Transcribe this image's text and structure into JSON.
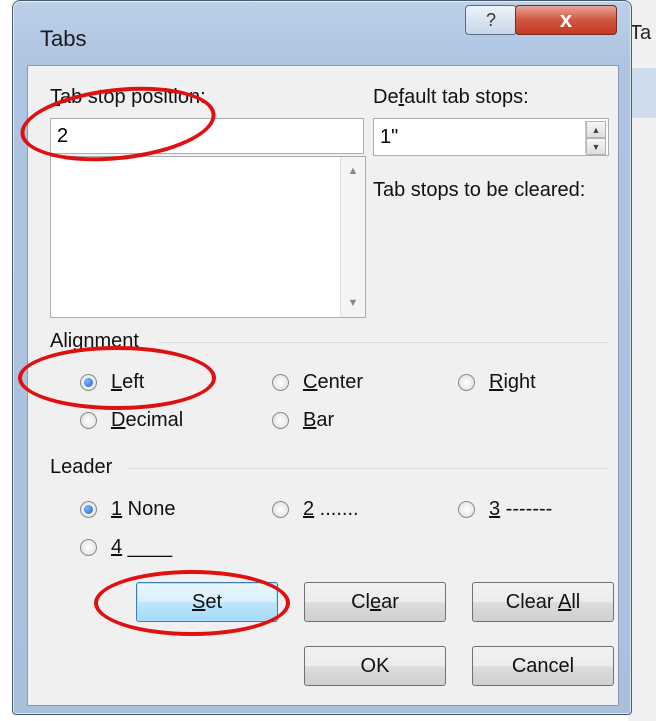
{
  "window": {
    "title": "Tabs",
    "help_glyph": "?",
    "close_glyph": "x",
    "background_app_text": "Ta"
  },
  "tab_stop_position": {
    "label": "Tab stop position:",
    "value": "2",
    "list_items": []
  },
  "default_tab_stops": {
    "label": "Default tab stops:",
    "value": "1\""
  },
  "tab_stops_cleared": {
    "label": "Tab stops to be cleared:"
  },
  "alignment": {
    "heading": "Alignment",
    "options": [
      {
        "label": "Left",
        "checked": true
      },
      {
        "label": "Center",
        "checked": false
      },
      {
        "label": "Right",
        "checked": false
      },
      {
        "label": "Decimal",
        "checked": false
      },
      {
        "label": "Bar",
        "checked": false
      }
    ]
  },
  "leader": {
    "heading": "Leader",
    "options": [
      {
        "label": "1 None",
        "checked": true
      },
      {
        "label": "2 .......",
        "checked": false
      },
      {
        "label": "3 -------",
        "checked": false
      },
      {
        "label": "4 ____",
        "checked": false
      }
    ]
  },
  "buttons": {
    "set": "Set",
    "clear": "Clear",
    "clear_all": "Clear All",
    "ok": "OK",
    "cancel": "Cancel"
  },
  "colors": {
    "annotation_ring": "#e01010",
    "radio_selected": "#1e5fc2",
    "close_button": "#c33a22"
  }
}
